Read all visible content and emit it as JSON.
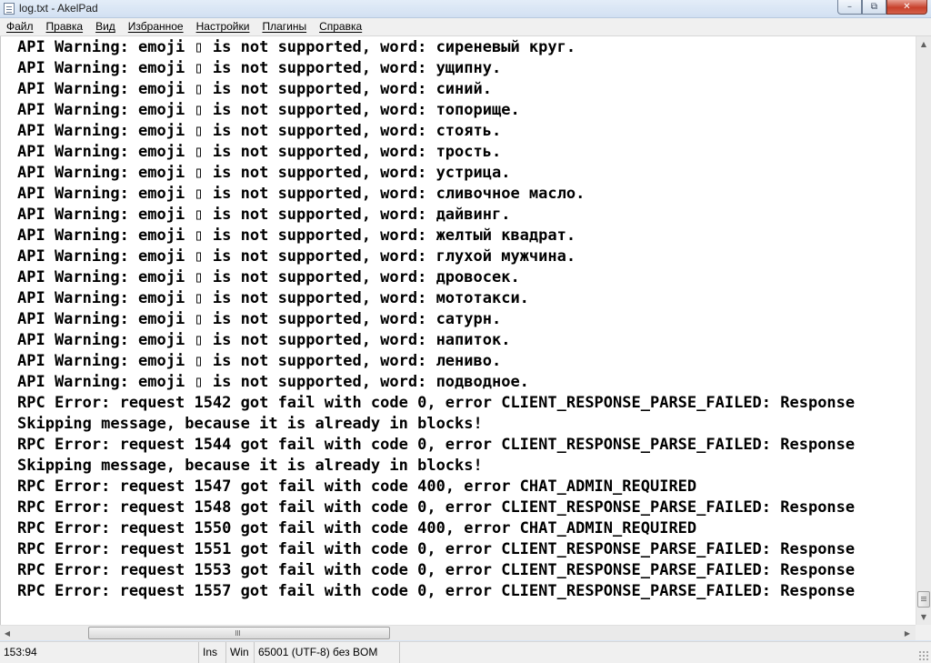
{
  "window": {
    "title": "log.txt - AkelPad",
    "min_glyph": "–",
    "max_glyph": "⧉",
    "close_glyph": "✕"
  },
  "menu": [
    "Файл",
    "Правка",
    "Вид",
    "Избранное",
    "Настройки",
    "Плагины",
    "Справка"
  ],
  "editor": {
    "lines": [
      "API Warning: emoji ▯ is not supported, word: сиреневый круг.",
      "API Warning: emoji ▯ is not supported, word: ущипну.",
      "API Warning: emoji ▯ is not supported, word: синий.",
      "API Warning: emoji ▯ is not supported, word: топорище.",
      "API Warning: emoji ▯ is not supported, word: стоять.",
      "API Warning: emoji ▯ is not supported, word: трость.",
      "API Warning: emoji ▯ is not supported, word: устрица.",
      "API Warning: emoji ▯ is not supported, word: сливочное масло.",
      "API Warning: emoji ▯ is not supported, word: дайвинг.",
      "API Warning: emoji ▯ is not supported, word: желтый квадрат.",
      "API Warning: emoji ▯ is not supported, word: глухой мужчина.",
      "API Warning: emoji ▯ is not supported, word: дровосек.",
      "API Warning: emoji ▯ is not supported, word: мототакси.",
      "API Warning: emoji ▯ is not supported, word: сатурн.",
      "API Warning: emoji ▯ is not supported, word: напиток.",
      "API Warning: emoji ▯ is not supported, word: лениво.",
      "API Warning: emoji ▯ is not supported, word: подводное.",
      "RPC Error: request 1542 got fail with code 0, error CLIENT_RESPONSE_PARSE_FAILED: Response",
      "Skipping message, because it is already in blocks!",
      "RPC Error: request 1544 got fail with code 0, error CLIENT_RESPONSE_PARSE_FAILED: Response",
      "Skipping message, because it is already in blocks!",
      "RPC Error: request 1547 got fail with code 400, error CHAT_ADMIN_REQUIRED",
      "RPC Error: request 1548 got fail with code 0, error CLIENT_RESPONSE_PARSE_FAILED: Response",
      "RPC Error: request 1550 got fail with code 400, error CHAT_ADMIN_REQUIRED",
      "RPC Error: request 1551 got fail with code 0, error CLIENT_RESPONSE_PARSE_FAILED: Response",
      "RPC Error: request 1553 got fail with code 0, error CLIENT_RESPONSE_PARSE_FAILED: Response",
      "RPC Error: request 1557 got fail with code 0, error CLIENT_RESPONSE_PARSE_FAILED: Response"
    ]
  },
  "scrollbars": {
    "up": "▲",
    "down": "▼",
    "left": "◀",
    "right": "▶"
  },
  "status": {
    "position": "153:94",
    "mode": "Ins",
    "newline": "Win",
    "encoding": "65001 (UTF-8) без BOM"
  }
}
